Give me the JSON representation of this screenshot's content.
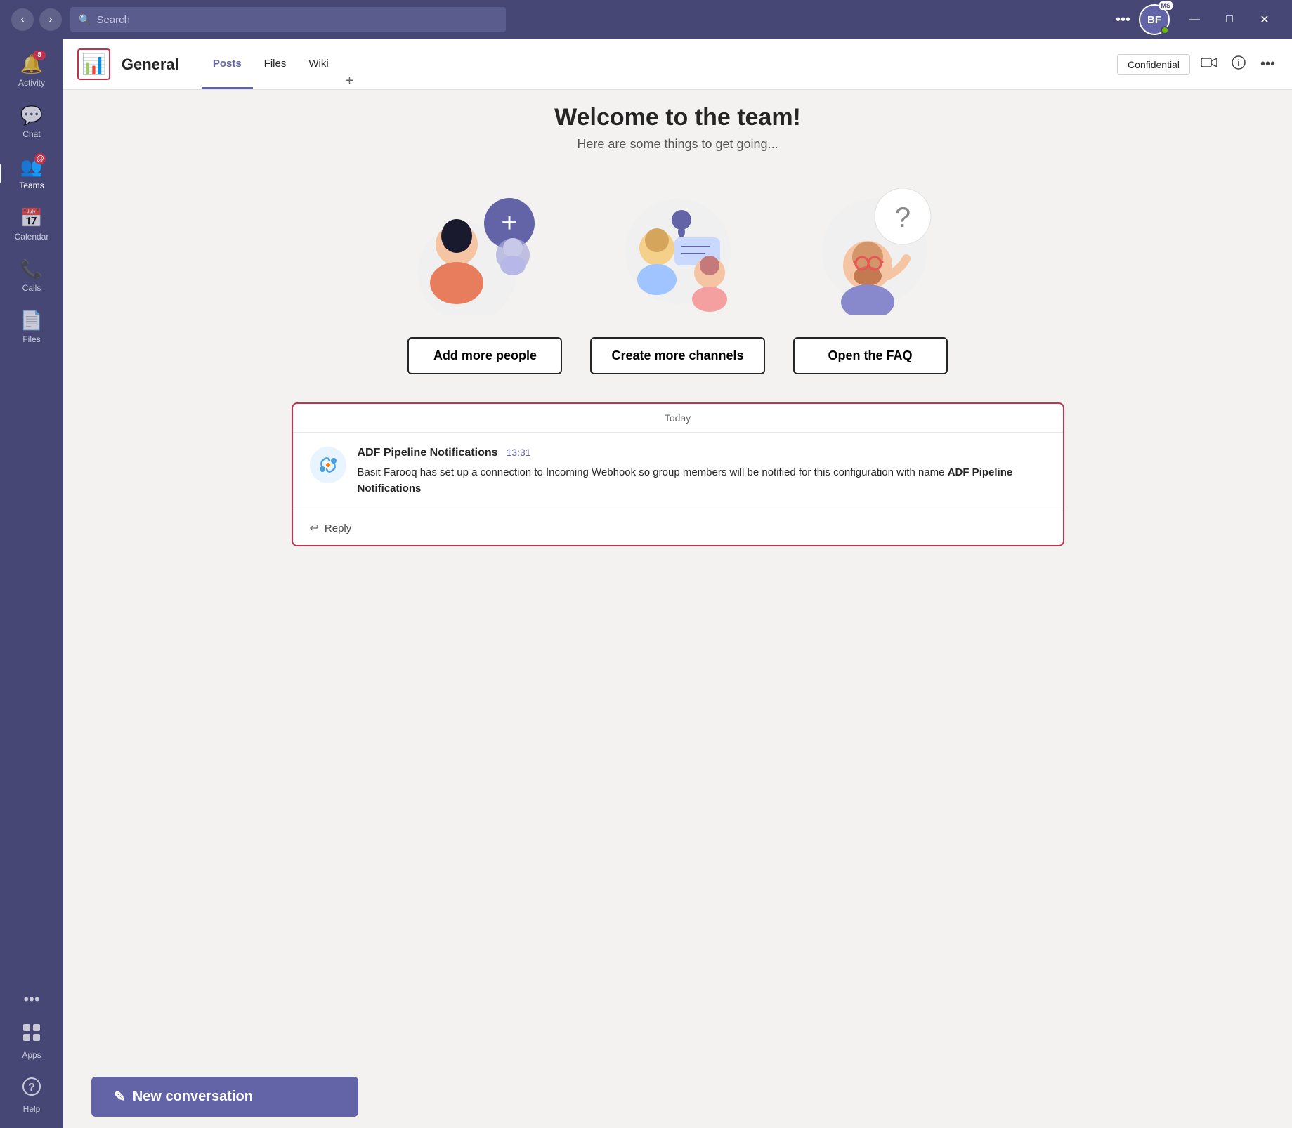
{
  "titlebar": {
    "search_placeholder": "Search",
    "avatar_initials": "BF",
    "ms_label": "MS",
    "back_arrow": "‹",
    "forward_arrow": "›",
    "more_label": "•••",
    "minimize": "—",
    "maximize": "□",
    "close": "✕"
  },
  "sidebar": {
    "items": [
      {
        "id": "activity",
        "label": "Activity",
        "icon": "🔔",
        "badge": "8",
        "badge_type": "number"
      },
      {
        "id": "chat",
        "label": "Chat",
        "icon": "💬",
        "badge": null
      },
      {
        "id": "teams",
        "label": "Teams",
        "icon": "👥",
        "badge": "@",
        "badge_type": "at",
        "active": true
      },
      {
        "id": "calendar",
        "label": "Calendar",
        "icon": "📅",
        "badge": null
      },
      {
        "id": "calls",
        "label": "Calls",
        "icon": "📞",
        "badge": null
      },
      {
        "id": "files",
        "label": "Files",
        "icon": "📄",
        "badge": null
      }
    ],
    "more_label": "•••",
    "apps_label": "Apps",
    "help_label": "Help"
  },
  "channel": {
    "name": "General",
    "tabs": [
      "Posts",
      "Files",
      "Wiki"
    ],
    "active_tab": "Posts",
    "add_tab": "+",
    "confidential_label": "Confidential",
    "more_label": "•••"
  },
  "welcome": {
    "title": "Welcome to the team!",
    "subtitle": "Here are some things to get going..."
  },
  "actions": [
    {
      "id": "add-people",
      "label": "Add more people"
    },
    {
      "id": "create-channels",
      "label": "Create more channels"
    },
    {
      "id": "open-faq",
      "label": "Open the FAQ"
    }
  ],
  "message_section": {
    "today_label": "Today",
    "sender": "ADF Pipeline Notifications",
    "time": "13:31",
    "text_plain": "Basit Farooq has set up a connection to Incoming Webhook so group members will be notified for this configuration with name ",
    "text_bold": "ADF Pipeline Notifications",
    "reply_label": "Reply"
  },
  "new_conversation": {
    "label": "New conversation",
    "icon": "✎"
  },
  "colors": {
    "sidebar_bg": "#464775",
    "accent": "#6264a7",
    "active_indicator": "#ffffff",
    "badge_bg": "#c4314b",
    "border_red": "#c4314b"
  }
}
